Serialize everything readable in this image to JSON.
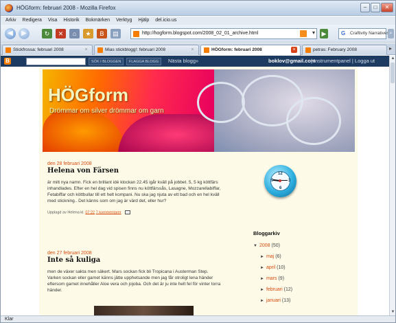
{
  "window": {
    "title": "HÖGform: februari 2008 - Mozilla Firefox"
  },
  "menu": [
    "Arkiv",
    "Redigera",
    "Visa",
    "Historik",
    "Bokmärken",
    "Verktyg",
    "Hjälp",
    "del.icio.us"
  ],
  "address": {
    "url": "http://hogform.blogspot.com/2008_02_01_archive.html"
  },
  "search": {
    "engine": "Craftivity Narratives"
  },
  "tabs": [
    {
      "label": "Stickfrossa: februari 2008"
    },
    {
      "label": "Mias stickblogg!: februari 2008"
    },
    {
      "label": "HÖGform: februari 2008"
    },
    {
      "label": "petras: February 2008"
    }
  ],
  "blogger_bar": {
    "logo": "B",
    "search_button": "SÖK I BLOGGEN",
    "flag_button": "FLAGGA BLOGG",
    "next": "Nästa blogg»",
    "user": "boklov@gmail.com",
    "links": "| Instrumentpanel | Logga ut"
  },
  "header": {
    "title": "HÖGform",
    "subtitle": "Drömmar om silver drömmar om garn"
  },
  "posts": [
    {
      "date": "den 28 februari 2008",
      "title": "Helena von Färsen",
      "body": "är mitt nya namn. Fick en brillant idé klockan 22.45 igår kväll på jobbet. 5, 5 kg köttfärs inhandlades. Efter en hel dag vid spisen finns nu köttfärssås, Lasagne, Mozzarellabiffar, Fetabiffar och köttbullar till ett helt kompani. Nu ska jag njuta av ett bad och en hel kväll med stickning.. Det känns som om jag är värd det, eller hur?",
      "footer_prefix": "Upplagd av Helena kl.",
      "time": "07:22",
      "comments": "7 kommentarer"
    },
    {
      "date": "den 27 februari 2008",
      "title": "Inte så kuliga",
      "body": "men de växer sakta men säkert. Mars sockan fick bli Tropicana i Austerman Step. Varken sockan eller garnet känns jätte upphetsande men jag får otroligt lena händer eftersom garnet innehåller Aloe vera och jojoba. Och det är ju inte helt fel för vinter torra händer."
    }
  ],
  "clock": {
    "n12": "12",
    "n3": "3",
    "n6": "6",
    "n9": "9",
    "hours": 9,
    "minutes": 15
  },
  "archive": {
    "heading": "Bloggarkiv",
    "year": "2008",
    "year_count": "(50)",
    "months": [
      {
        "name": "maj",
        "count": "(6)"
      },
      {
        "name": "april",
        "count": "(10)"
      },
      {
        "name": "mars",
        "count": "(9)"
      },
      {
        "name": "februari",
        "count": "(12)"
      },
      {
        "name": "januari",
        "count": "(13)"
      }
    ]
  },
  "status": {
    "text": "Klar"
  },
  "colors": {
    "accent": "#d64a0f",
    "blogger_bar": "#1d3b61",
    "page_bg": "#fdfbe8"
  }
}
